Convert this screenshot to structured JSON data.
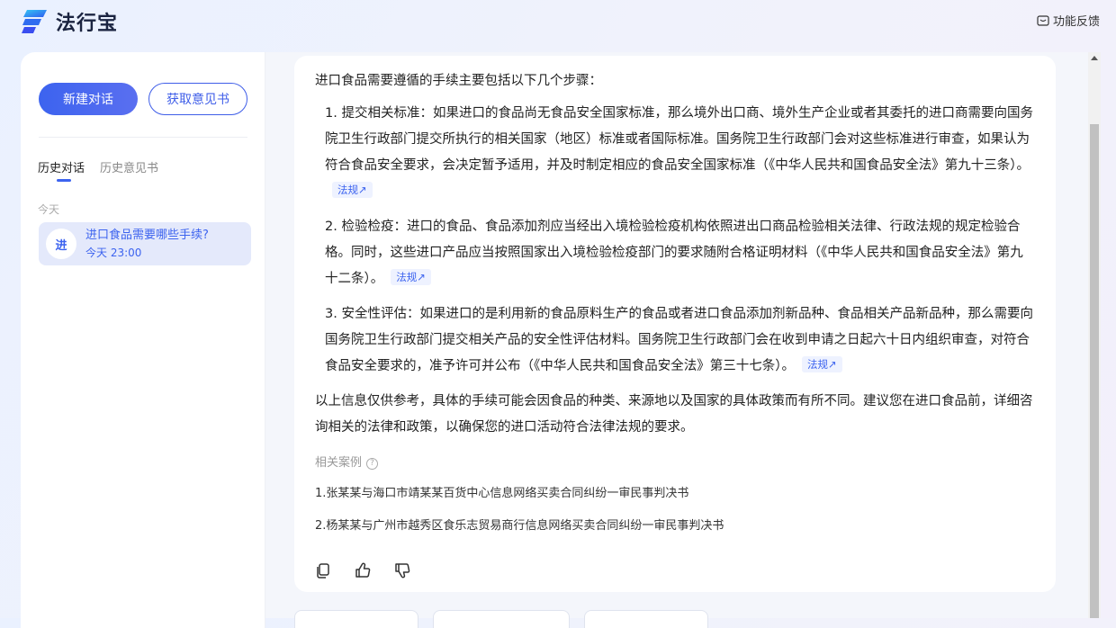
{
  "app": {
    "logo_text": "法行宝",
    "feedback_label": "功能反馈",
    "colors": {
      "accent": "#3c63ef",
      "tag_bg": "#eef2ff"
    }
  },
  "sidebar": {
    "new_chat_label": "新建对话",
    "get_opinion_label": "获取意见书",
    "tabs": [
      {
        "label": "历史对话",
        "active": true
      },
      {
        "label": "历史意见书",
        "active": false
      }
    ],
    "groups": [
      {
        "label": "今天",
        "items": [
          {
            "avatar": "进",
            "title": "进口食品需要哪些手续?",
            "time": "今天 23:00"
          }
        ]
      }
    ]
  },
  "answer": {
    "intro": "进口食品需要遵循的手续主要包括以下几个步骤：",
    "steps": [
      {
        "text": "1. 提交相关标准：如果进口的食品尚无食品安全国家标准，那么境外出口商、境外生产企业或者其委托的进口商需要向国务院卫生行政部门提交所执行的相关国家（地区）标准或者国际标准。国务院卫生行政部门会对这些标准进行审查，如果认为符合食品安全要求，会决定暂予适用，并及时制定相应的食品安全国家标准（《中华人民共和国食品安全法》第九十三条）。",
        "tag": "法规↗"
      },
      {
        "text": "2. 检验检疫：进口的食品、食品添加剂应当经出入境检验检疫机构依照进出口商品检验相关法律、行政法规的规定检验合格。同时，这些进口产品应当按照国家出入境检验检疫部门的要求随附合格证明材料（《中华人民共和国食品安全法》第九十二条）。",
        "tag": "法规↗"
      },
      {
        "text": "3. 安全性评估：如果进口的是利用新的食品原料生产的食品或者进口食品添加剂新品种、食品相关产品新品种，那么需要向国务院卫生行政部门提交相关产品的安全性评估材料。国务院卫生行政部门会在收到申请之日起六十日内组织审查，对符合食品安全要求的，准予许可并公布（《中华人民共和国食品安全法》第三十七条）。",
        "tag": "法规↗"
      }
    ],
    "conclusion": "以上信息仅供参考，具体的手续可能会因食品的种类、来源地以及国家的具体政策而有所不同。建议您在进口食品前，详细咨询相关的法律和政策，以确保您的进口活动符合法律法规的要求。",
    "related_label": "相关案例",
    "cases": [
      "1.张某某与海口市靖某某百货中心信息网络买卖合同纠纷一审民事判决书",
      "2.杨某某与广州市越秀区食乐志贸易商行信息网络买卖合同纠纷一审民事判决书"
    ]
  }
}
